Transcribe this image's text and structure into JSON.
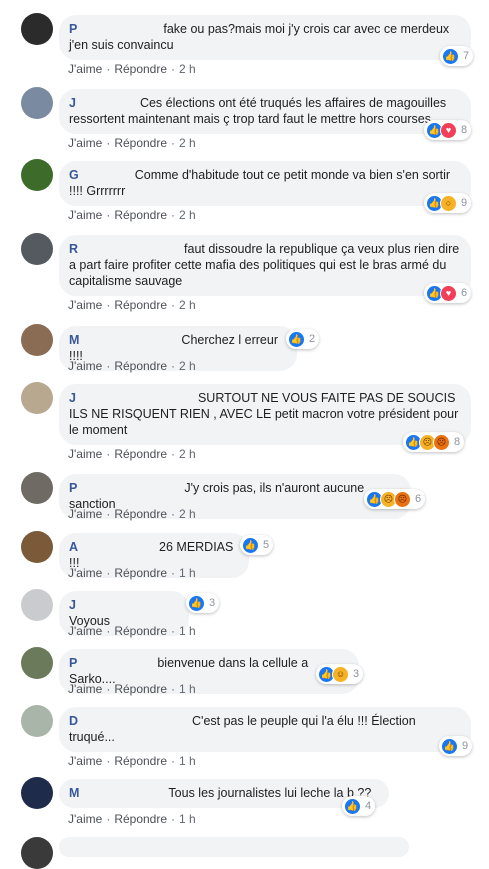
{
  "comments": [
    {
      "initial": "P",
      "text": "fake ou pas?mais moi j'y crois car avec ce merdeux j'en suis convaincu",
      "like": "J'aime",
      "reply": "Répondre",
      "time": "2 h",
      "reactions": [
        "like"
      ],
      "count": "7"
    },
    {
      "initial": "J",
      "text": "Ces élections ont été truqués les affaires de magouilles ressortent maintenant mais ç trop tard faut le mettre hors courses",
      "like": "J'aime",
      "reply": "Répondre",
      "time": "2 h",
      "reactions": [
        "like",
        "love"
      ],
      "count": "8"
    },
    {
      "initial": "G",
      "text": "Comme d'habitude tout ce petit monde va bien s'en sortir !!!! Grrrrrrr",
      "like": "J'aime",
      "reply": "Répondre",
      "time": "2 h",
      "reactions": [
        "like",
        "wow"
      ],
      "count": "9"
    },
    {
      "initial": "R",
      "text": "faut dissoudre la republique ça veux plus rien dire a part faire profiter cette mafia des politiques qui est le bras armé du capitalisme sauvage",
      "like": "J'aime",
      "reply": "Répondre",
      "time": "2 h",
      "reactions": [
        "like",
        "love"
      ],
      "count": "6"
    },
    {
      "initial": "M",
      "text": "Cherchez l erreur !!!!",
      "like": "J'aime",
      "reply": "Répondre",
      "time": "2 h",
      "reactions": [
        "like"
      ],
      "count": "2"
    },
    {
      "initial": "J",
      "text": "SURTOUT NE VOUS FAITE PAS DE SOUCIS ILS NE RISQUENT RIEN , AVEC LE petit macron votre président pour le moment",
      "like": "J'aime",
      "reply": "Répondre",
      "time": "2 h",
      "reactions": [
        "like",
        "sad",
        "angry"
      ],
      "count": "8"
    },
    {
      "initial": "P",
      "text": "J'y crois pas, ils n'auront aucune sanction",
      "like": "J'aime",
      "reply": "Répondre",
      "time": "2 h",
      "reactions": [
        "like",
        "sad",
        "angry"
      ],
      "count": "6"
    },
    {
      "initial": "A",
      "text": "26 MERDIAS !!!",
      "like": "J'aime",
      "reply": "Répondre",
      "time": "1 h",
      "reactions": [
        "like"
      ],
      "count": "5"
    },
    {
      "initial": "J",
      "text": "Voyous",
      "like": "J'aime",
      "reply": "Répondre",
      "time": "1 h",
      "reactions": [
        "like"
      ],
      "count": "3"
    },
    {
      "initial": "P",
      "text": "bienvenue dans la cellule a Sarko....",
      "like": "J'aime",
      "reply": "Répondre",
      "time": "1 h",
      "reactions": [
        "like",
        "haha"
      ],
      "count": "3"
    },
    {
      "initial": "D",
      "text": "C'est pas le peuple qui l'a élu !!! Élection truqué...",
      "like": "J'aime",
      "reply": "Répondre",
      "time": "1 h",
      "reactions": [
        "like"
      ],
      "count": "9"
    },
    {
      "initial": "M",
      "text": "Tous les journalistes lui leche la b ??",
      "like": "J'aime",
      "reply": "Répondre",
      "time": "1 h",
      "reactions": [
        "like"
      ],
      "count": "4"
    }
  ],
  "colors": {
    "bubble": "#f2f3f5",
    "author": "#385898",
    "like_blue": "#1877f2",
    "love_red": "#f33e58",
    "yellow": "#f7b125"
  },
  "icons": {
    "like": "thumbs-up-icon",
    "love": "heart-icon",
    "wow": "wow-face-icon",
    "sad": "sad-face-icon",
    "angry": "angry-face-icon",
    "haha": "haha-face-icon"
  }
}
